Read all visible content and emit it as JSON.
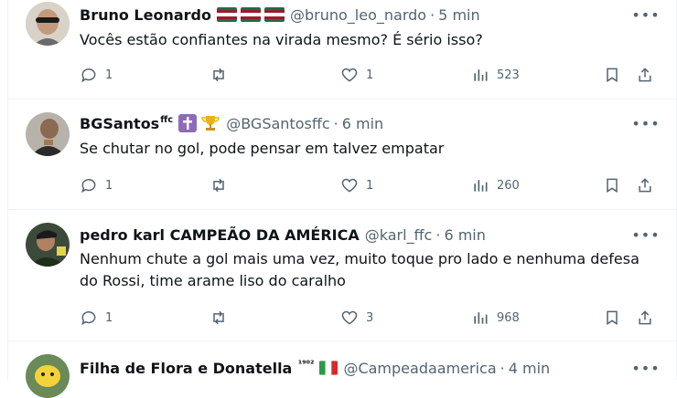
{
  "tweets": [
    {
      "name": "Bruno Leonardo",
      "handle": "@bruno_leo_nardo",
      "time": "5 min",
      "text": "Vocês estão confiantes na virada mesmo? É sério isso?",
      "replies": "1",
      "likes": "1",
      "views": "523",
      "badges": [
        "flag-flu",
        "flag-flu",
        "flag-flu"
      ]
    },
    {
      "name": "BGSantos",
      "name_sup": "ffc",
      "handle": "@BGSantosffc",
      "time": "6 min",
      "text": "Se chutar no gol, pode pensar em talvez empatar",
      "replies": "1",
      "likes": "1",
      "views": "260",
      "badges": [
        "cross-emoji",
        "trophy-emoji"
      ]
    },
    {
      "name": "pedro karl CAMPEÃO DA AMÉRICA",
      "handle": "@karl_ffc",
      "time": "6 min",
      "text": "Nenhum chute a gol mais uma vez, muito toque pro lado e nenhuma defesa do Rossi, time arame liso do caralho",
      "replies": "1",
      "likes": "3",
      "views": "968",
      "badges": []
    },
    {
      "name": "Filha de Flora e Donatella",
      "name_sup": "¹⁹⁰²",
      "handle": "@Campeadaamerica",
      "time": "4 min",
      "badges": [
        "flag-italy"
      ]
    }
  ],
  "colors": {
    "text": "#0f1419",
    "muted": "#536471",
    "border": "#eff3f4",
    "flu_red": "#9b1b30",
    "flu_green": "#1f6e43",
    "cross_purple": "#8e6bb8"
  }
}
